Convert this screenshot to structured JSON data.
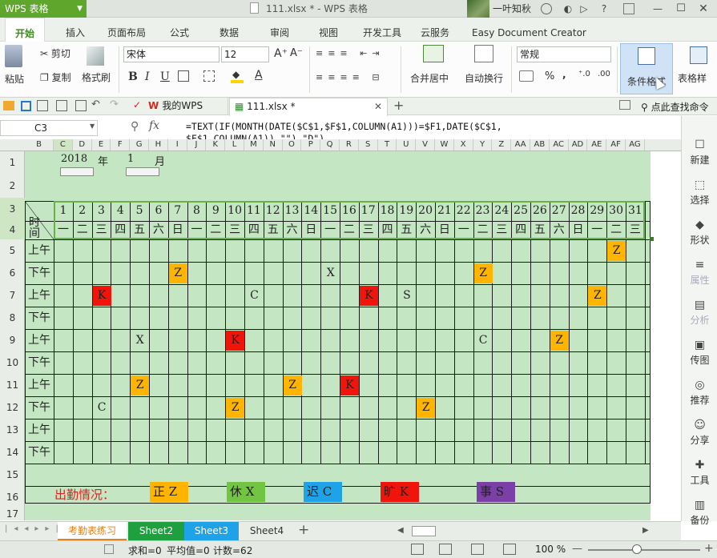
{
  "app": {
    "name": "WPS 表格",
    "doc_title": "111.xlsx * - WPS 表格",
    "user": "一叶知秋"
  },
  "ribbon_tabs": [
    "开始",
    "插入",
    "页面布局",
    "公式",
    "数据",
    "审阅",
    "视图",
    "开发工具",
    "云服务",
    "Easy Document Creator"
  ],
  "ribbon": {
    "cut": "剪切",
    "paste": "粘贴",
    "copy": "复制",
    "format_painter": "格式刷",
    "font_name": "宋体",
    "font_size": "12",
    "bold": "B",
    "italic": "I",
    "underline": "U",
    "merge_center": "合并居中",
    "wrap_text": "自动换行",
    "number_format": "常规",
    "percent": "%",
    "comma": ",",
    "conditional_format": "条件格式",
    "table_style": "表格样"
  },
  "doctabs": {
    "my_wps": "我的WPS",
    "file": "111.xlsx *",
    "search": "点此查找命令"
  },
  "formula_bar": {
    "cell_ref": "C3",
    "fx": "fx",
    "formula": "=TEXT(IF(MONTH(DATE($C$1,$F$1,COLUMN(A1)))=$F1,DATE($C$1,\n$F$1,COLUMN(A1)),\"\"),\"D\")"
  },
  "column_headers": [
    "B",
    "C",
    "D",
    "E",
    "F",
    "G",
    "H",
    "I",
    "J",
    "K",
    "L",
    "M",
    "N",
    "O",
    "P",
    "Q",
    "R",
    "S",
    "T",
    "U",
    "V",
    "W",
    "X",
    "Y",
    "Z",
    "AA",
    "AB",
    "AC",
    "AD",
    "AE",
    "AF",
    "AG"
  ],
  "row_headers": [
    "1",
    "2",
    "3",
    "4",
    "5",
    "6",
    "7",
    "8",
    "9",
    "10",
    "11",
    "12",
    "13",
    "14",
    "15",
    "16",
    "17"
  ],
  "sheet": {
    "year": "2018",
    "year_unit": "年",
    "month": "1",
    "month_unit": "月",
    "corner_label": "时间",
    "days": [
      "1",
      "2",
      "3",
      "4",
      "5",
      "6",
      "7",
      "8",
      "9",
      "10",
      "11",
      "12",
      "13",
      "14",
      "15",
      "16",
      "17",
      "18",
      "19",
      "20",
      "21",
      "22",
      "23",
      "24",
      "25",
      "26",
      "27",
      "28",
      "29",
      "30",
      "31"
    ],
    "weekdays": [
      "一",
      "二",
      "三",
      "四",
      "五",
      "六",
      "日",
      "一",
      "二",
      "三",
      "四",
      "五",
      "六",
      "日",
      "一",
      "二",
      "三",
      "四",
      "五",
      "六",
      "日",
      "一",
      "二",
      "三",
      "四",
      "五",
      "六",
      "日",
      "一",
      "二",
      "三"
    ],
    "periods": [
      "上午",
      "下午",
      "上午",
      "下午",
      "上午",
      "下午",
      "上午",
      "下午",
      "上午",
      "下午"
    ],
    "marks": [
      {
        "row": 0,
        "day": 30,
        "text": "Z",
        "color": "#ffb400"
      },
      {
        "row": 1,
        "day": 7,
        "text": "Z",
        "color": "#ffb400"
      },
      {
        "row": 1,
        "day": 15,
        "text": "X",
        "color": ""
      },
      {
        "row": 1,
        "day": 23,
        "text": "Z",
        "color": "#ffb400"
      },
      {
        "row": 2,
        "day": 3,
        "text": "K",
        "color": "#f0140a"
      },
      {
        "row": 2,
        "day": 11,
        "text": "C",
        "color": ""
      },
      {
        "row": 2,
        "day": 17,
        "text": "K",
        "color": "#f0140a"
      },
      {
        "row": 2,
        "day": 19,
        "text": "S",
        "color": ""
      },
      {
        "row": 2,
        "day": 29,
        "text": "Z",
        "color": "#ffb400"
      },
      {
        "row": 4,
        "day": 5,
        "text": "X",
        "color": ""
      },
      {
        "row": 4,
        "day": 10,
        "text": "K",
        "color": "#f0140a"
      },
      {
        "row": 4,
        "day": 23,
        "text": "C",
        "color": ""
      },
      {
        "row": 4,
        "day": 27,
        "text": "Z",
        "color": "#ffb400"
      },
      {
        "row": 6,
        "day": 5,
        "text": "Z",
        "color": "#ffb400"
      },
      {
        "row": 6,
        "day": 13,
        "text": "Z",
        "color": "#ffb400"
      },
      {
        "row": 6,
        "day": 16,
        "text": "K",
        "color": "#f0140a"
      },
      {
        "row": 7,
        "day": 3,
        "text": "C",
        "color": ""
      },
      {
        "row": 7,
        "day": 10,
        "text": "Z",
        "color": "#ffb400"
      },
      {
        "row": 7,
        "day": 20,
        "text": "Z",
        "color": "#ffb400"
      }
    ],
    "legend_title": "出勤情况：",
    "legend": [
      {
        "label": "正",
        "code": "Z",
        "color": "#ffb400"
      },
      {
        "label": "休",
        "code": "X",
        "color": "#72c540"
      },
      {
        "label": "迟",
        "code": "C",
        "color": "#1fa3e8"
      },
      {
        "label": "旷",
        "code": "K",
        "color": "#f0140a"
      },
      {
        "label": "事",
        "code": "S",
        "color": "#7b3fa8"
      }
    ]
  },
  "right_panel": [
    "新建",
    "选择",
    "形状",
    "属性",
    "分析",
    "传图",
    "推荐",
    "分享",
    "工具",
    "备份"
  ],
  "sheet_tabs": [
    "考勤表练习",
    "Sheet2",
    "Sheet3",
    "Sheet4"
  ],
  "status": {
    "sum": "求和=0",
    "avg": "平均值=0",
    "count": "计数=62",
    "zoom": "100 %"
  },
  "colors": {
    "accent": "#5fa62d",
    "sheet_bg": "#c5e6c3",
    "header_green": "#6bb046"
  }
}
